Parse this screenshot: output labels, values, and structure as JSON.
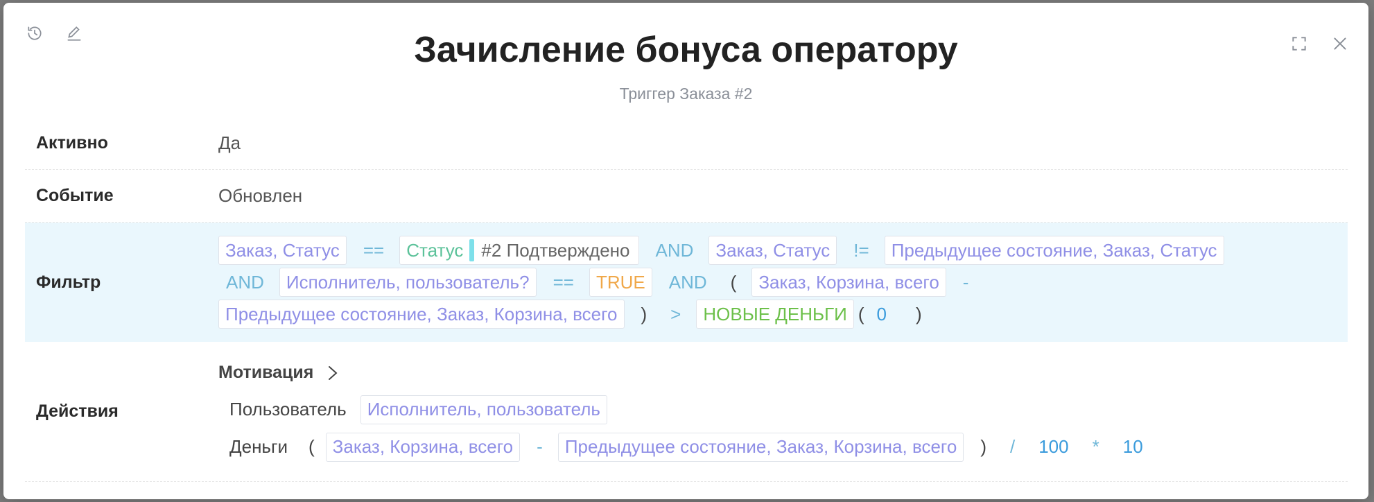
{
  "modal": {
    "title": "Зачисление бонуса оператору",
    "subtitle": "Триггер Заказа #2"
  },
  "toolbar": {
    "history_icon": "history-icon",
    "edit_icon": "edit-icon",
    "expand_icon": "expand-icon",
    "close_icon": "close-icon"
  },
  "rows": {
    "active": {
      "label": "Активно",
      "value": "Да"
    },
    "event": {
      "label": "Событие",
      "value": "Обновлен"
    },
    "filter": {
      "label": "Фильтр",
      "tokens": {
        "t1": "Заказ, Статус",
        "op_eq1": "==",
        "status_name": "Статус",
        "status_value": "#2 Подтверждено",
        "and1": "AND",
        "t2": "Заказ, Статус",
        "op_ne": "!=",
        "t3": "Предыдущее состояние, Заказ, Статус",
        "and2": "AND",
        "t4": "Исполнитель, пользователь?",
        "op_eq2": "==",
        "t5": "TRUE",
        "and3": "AND",
        "paren_open": "(",
        "t6": "Заказ, Корзина, всего",
        "op_minus": "-",
        "t7": "Предыдущее состояние, Заказ, Корзина, всего",
        "paren_close": ")",
        "op_gt": ">",
        "t8": "НОВЫЕ ДЕНЬГИ",
        "paren_open2": "(",
        "num_zero": "0",
        "paren_close2": ")"
      }
    },
    "actions": {
      "label": "Действия",
      "motivation": "Мотивация",
      "user_label": "Пользователь",
      "user_value": "Исполнитель, пользователь",
      "money_label": "Деньги",
      "money": {
        "paren_open": "(",
        "a": "Заказ, Корзина, всего",
        "op_minus": "-",
        "b": "Предыдущее состояние, Заказ, Корзина, всего",
        "paren_close": ")",
        "op_div": "/",
        "n1": "100",
        "op_mul": "*",
        "n2": "10"
      }
    }
  }
}
